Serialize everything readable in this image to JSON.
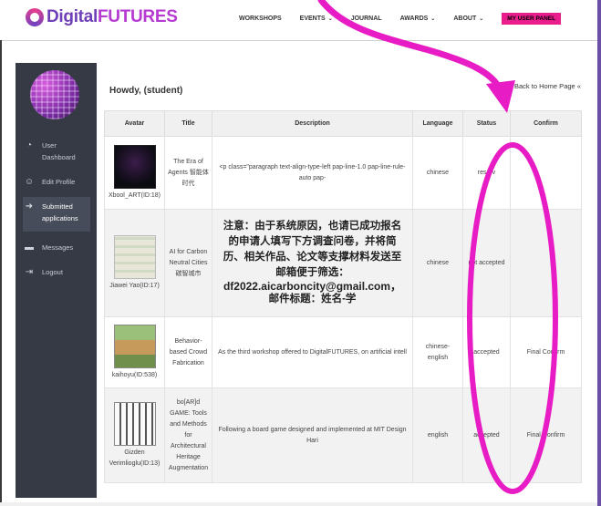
{
  "header": {
    "logo_digital": "Digital",
    "logo_futures": "FUTURES",
    "nav": [
      {
        "label": "WORKSHOPS",
        "caret": ""
      },
      {
        "label": "EVENTS",
        "caret": "⌄"
      },
      {
        "label": "JOURNAL",
        "caret": ""
      },
      {
        "label": "AWARDS",
        "caret": "⌄"
      },
      {
        "label": "ABOUT",
        "caret": "⌄"
      }
    ],
    "panel_button": "MY USER PANEL"
  },
  "sidebar": {
    "items": [
      {
        "label": "User Dashboard",
        "icon": "dashboard-icon"
      },
      {
        "label": "Edit Profile",
        "icon": "user-icon"
      },
      {
        "label": "Submitted applications",
        "icon": "sign-in-icon"
      },
      {
        "label": "Messages",
        "icon": "message-icon"
      },
      {
        "label": "Logout",
        "icon": "logout-icon"
      }
    ]
  },
  "main": {
    "greeting": "Howdy, (student)",
    "back_link": "Back to Home Page «",
    "columns": [
      "Avatar",
      "Title",
      "Description",
      "Language",
      "Status",
      "Confirm"
    ],
    "rows": [
      {
        "avatar_name": "Xbool_ART(ID:18)",
        "title": "The Era of Agents 智能体时代",
        "description": "<p class=\"paragraph text-align-type-left pap-line-1.0 pap-line-rule-auto pap-",
        "language": "chinese",
        "status": "reserv",
        "confirm": ""
      },
      {
        "avatar_name": "Jiawei Yao(ID:17)",
        "title": "AI for Carbon Neutral Cities 碳智城市",
        "description_lines": [
          "注意：由于系统原因，也请已成功报名",
          "的申请人填写下方调查问卷，并将简",
          "历、相关作品、论文等支撑材料发送至",
          "邮箱便于筛选：",
          "df2022.aicarboncity@gmail.com，",
          "邮件标题：姓名-学"
        ],
        "language": "chinese",
        "status": "not accepted",
        "confirm": ""
      },
      {
        "avatar_name": "kaihoyu(ID:538)",
        "title": "Behavior-based Crowd Fabrication",
        "description": "As the third workshop offered to DigitalFUTURES, on artificial intell",
        "language": "chinese-english",
        "status": "accepted",
        "confirm": "Final Confirm"
      },
      {
        "avatar_name": "Gizden Verimlioglu(ID:13)",
        "title": "bo[AR]d GAME: Tools and Methods for Architectural Heritage Augmentation",
        "description": "Following a board game designed and implemented at MIT Design Hari",
        "language": "english",
        "status": "accepted",
        "confirm": "Final Confirm"
      }
    ]
  },
  "colors": {
    "brand_purple": "#6f3fb8",
    "brand_magenta": "#e91e8c",
    "sidebar_bg": "#353a45",
    "annotation": "#e81cc4"
  }
}
